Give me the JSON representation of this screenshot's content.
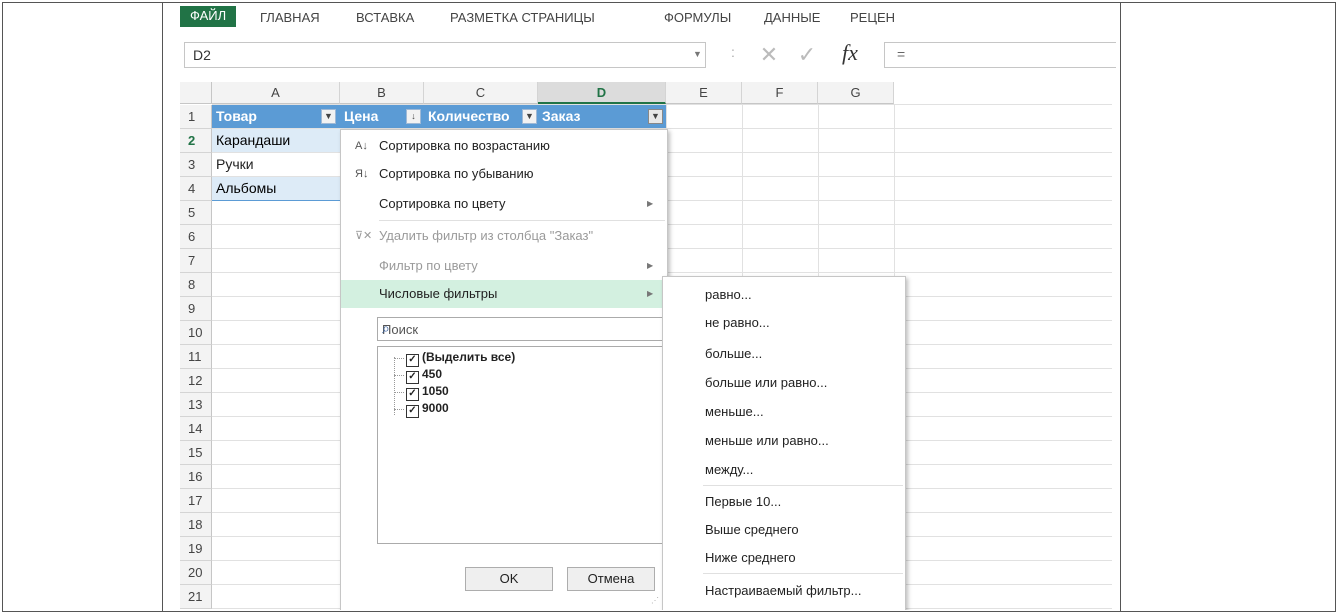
{
  "ribbon": {
    "tabs": [
      "ФАЙЛ",
      "ГЛАВНАЯ",
      "ВСТАВКА",
      "РАЗМЕТКА СТРАНИЦЫ",
      "ФОРМУЛЫ",
      "ДАННЫЕ",
      "РЕЦЕН"
    ]
  },
  "formula_bar": {
    "name_box": "D2",
    "separator": ":",
    "cancel_glyph": "✕",
    "enter_glyph": "✓",
    "fx_label": "fx",
    "bar_text": "="
  },
  "columns": [
    "A",
    "B",
    "C",
    "D",
    "E",
    "F",
    "G"
  ],
  "selected_column": "D",
  "rows": [
    "1",
    "2",
    "3",
    "4",
    "5",
    "6",
    "7",
    "8",
    "9",
    "10",
    "11",
    "12",
    "13",
    "14",
    "15",
    "16",
    "17",
    "18",
    "19",
    "20",
    "21"
  ],
  "selected_row": "2",
  "table": {
    "headers": [
      "Товар",
      "Цена",
      "Количество",
      "Заказ"
    ],
    "items": [
      "Карандаши",
      "Ручки",
      "Альбомы"
    ]
  },
  "filter_menu": {
    "sort_asc": "Сортировка по возрастанию",
    "sort_desc": "Сортировка по убыванию",
    "sort_color": "Сортировка по цвету",
    "clear_filter": "Удалить фильтр из столбца \"Заказ\"",
    "filter_color": "Фильтр по цвету",
    "number_filters": "Числовые фильтры",
    "search_placeholder": "Поиск",
    "list": [
      "(Выделить все)",
      "450",
      "1050",
      "9000"
    ],
    "ok": "OK",
    "cancel": "Отмена"
  },
  "number_filters_submenu": [
    "равно...",
    "не равно...",
    "больше...",
    "больше или равно...",
    "меньше...",
    "меньше или равно...",
    "между...",
    "Первые 10...",
    "Выше среднего",
    "Ниже среднего",
    "Настраиваемый фильтр..."
  ],
  "colors": {
    "accent": "#217346",
    "table_header": "#5b9bd5",
    "band": "#ddebf7",
    "highlight": "#d3f0e0"
  }
}
